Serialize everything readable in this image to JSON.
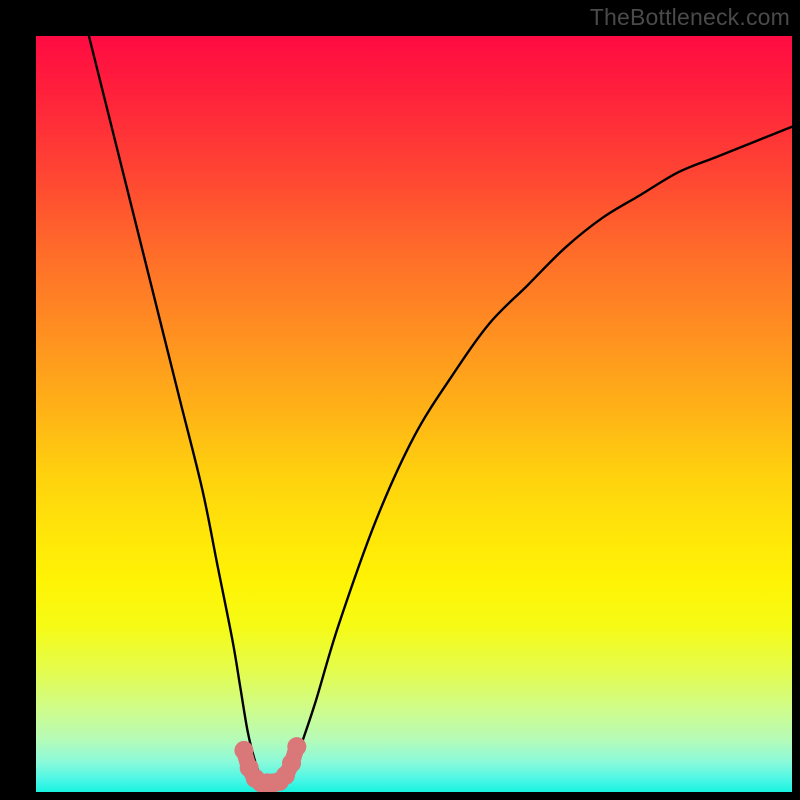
{
  "watermark": "TheBottleneck.com",
  "chart_data": {
    "type": "line",
    "title": "",
    "xlabel": "",
    "ylabel": "",
    "xlim": [
      0,
      100
    ],
    "ylim": [
      0,
      100
    ],
    "annotations": [],
    "series": [
      {
        "name": "bottleneck-curve",
        "color": "#000000",
        "x": [
          7,
          10,
          13,
          16,
          19,
          22,
          24,
          26,
          27,
          28,
          29,
          30,
          31,
          32,
          33,
          34,
          35,
          37,
          40,
          45,
          50,
          55,
          60,
          65,
          70,
          75,
          80,
          85,
          90,
          95,
          100
        ],
        "values": [
          100,
          88,
          76,
          64,
          52,
          40,
          30,
          20,
          14,
          8,
          4,
          1.5,
          1.2,
          1.2,
          1.5,
          3,
          6,
          12,
          22,
          36,
          47,
          55,
          62,
          67,
          72,
          76,
          79,
          82,
          84,
          86,
          88
        ]
      },
      {
        "name": "valley-highlight",
        "color": "#d97779",
        "x": [
          27.5,
          28.2,
          29,
          29.8,
          30.6,
          31.4,
          32.2,
          33,
          33.8,
          34.5
        ],
        "values": [
          5.5,
          3.2,
          1.8,
          1.2,
          1.2,
          1.2,
          1.4,
          2.2,
          3.8,
          6.0
        ]
      }
    ],
    "background": {
      "type": "vertical-gradient",
      "stops": [
        {
          "pos": 0,
          "color": "#ff0b42"
        },
        {
          "pos": 50,
          "color": "#ffb416"
        },
        {
          "pos": 78,
          "color": "#e4fc4e"
        },
        {
          "pos": 100,
          "color": "#18f3de"
        }
      ]
    }
  }
}
